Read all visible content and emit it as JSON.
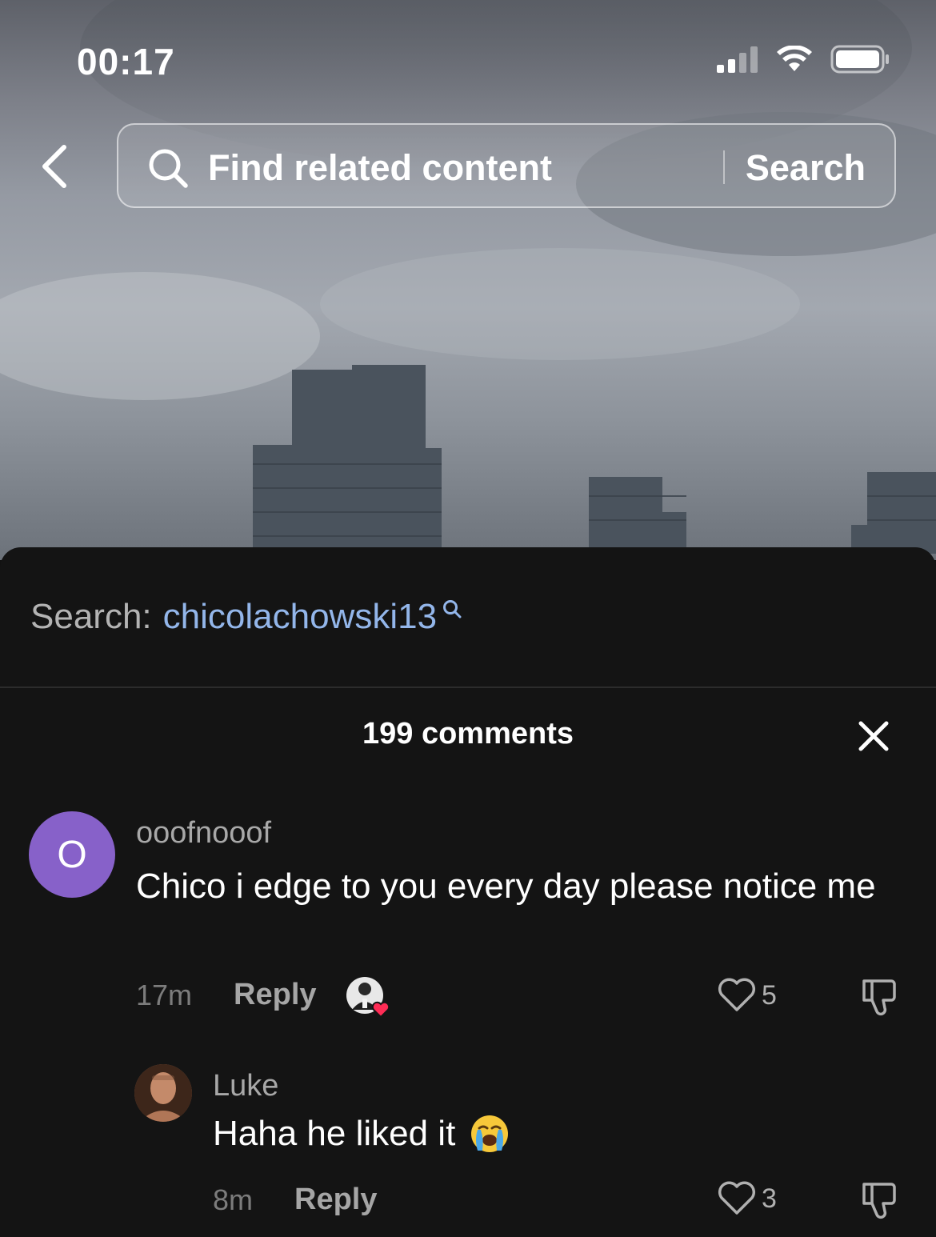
{
  "status_bar": {
    "time": "00:17",
    "icons": [
      "cellular-signal-icon",
      "wifi-icon",
      "battery-icon"
    ]
  },
  "header": {
    "back_icon": "chevron-left-icon",
    "search": {
      "icon": "search-icon",
      "placeholder": "Find related content",
      "button_label": "Search"
    }
  },
  "sheet": {
    "search_suggestion": {
      "prefix": "Search:",
      "term": "chicolachowski13",
      "icon": "search-icon"
    },
    "comments_title": "199 comments",
    "close_icon": "close-icon",
    "comments": [
      {
        "avatar_letter": "O",
        "avatar_color": "#8761c9",
        "username": "ooofnooof",
        "text": "Chico i edge to you every day please notice me",
        "time": "17m",
        "reply_label": "Reply",
        "liked_by_creator": true,
        "likes": "5"
      },
      {
        "username": "Luke",
        "text": "Haha he liked it",
        "emoji": "loudly-crying-face-emoji",
        "time": "8m",
        "reply_label": "Reply",
        "likes": "3"
      }
    ]
  },
  "colors": {
    "sheet_bg": "#141414",
    "link_blue": "#93b6ea",
    "creator_heart": "#fe2c55"
  }
}
